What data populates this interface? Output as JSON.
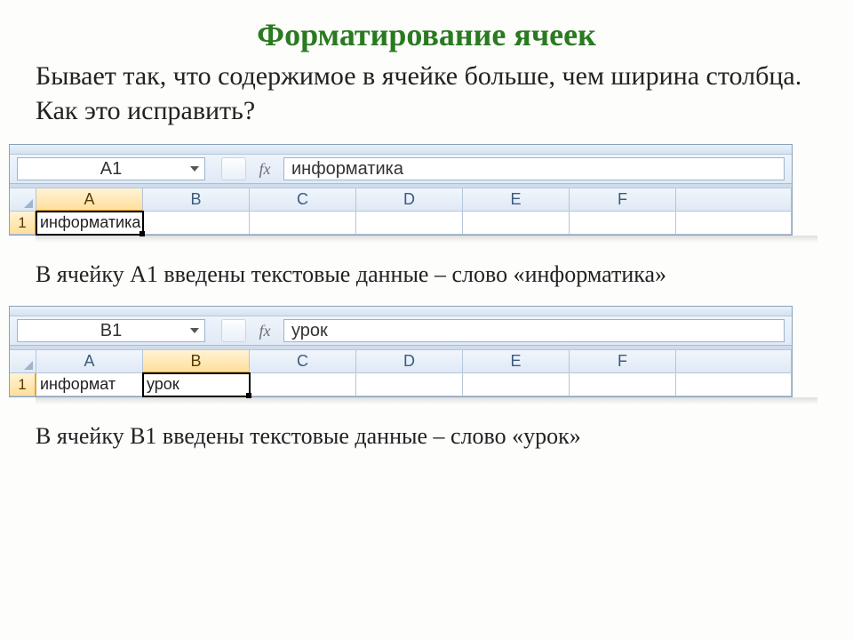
{
  "title": "Форматирование ячеек",
  "intro": "Бывает так, что содержимое в ячейке больше, чем ширина столбца. Как это исправить?",
  "caption1": "В ячейку А1 введены текстовые данные – слово «информатика»",
  "caption2": "В ячейку В1 введены текстовые данные – слово «урок»",
  "fx_label": "fx",
  "columns": [
    "A",
    "B",
    "C",
    "D",
    "E",
    "F"
  ],
  "row_label": "1",
  "shot1": {
    "namebox": "A1",
    "formula": "информатика",
    "active_col_index": 0,
    "cells": {
      "A1_full": "информатика",
      "B1": ""
    }
  },
  "shot2": {
    "namebox": "B1",
    "formula": "урок",
    "active_col_index": 1,
    "cells": {
      "A1_clipped": "информат",
      "B1": "урок"
    }
  }
}
